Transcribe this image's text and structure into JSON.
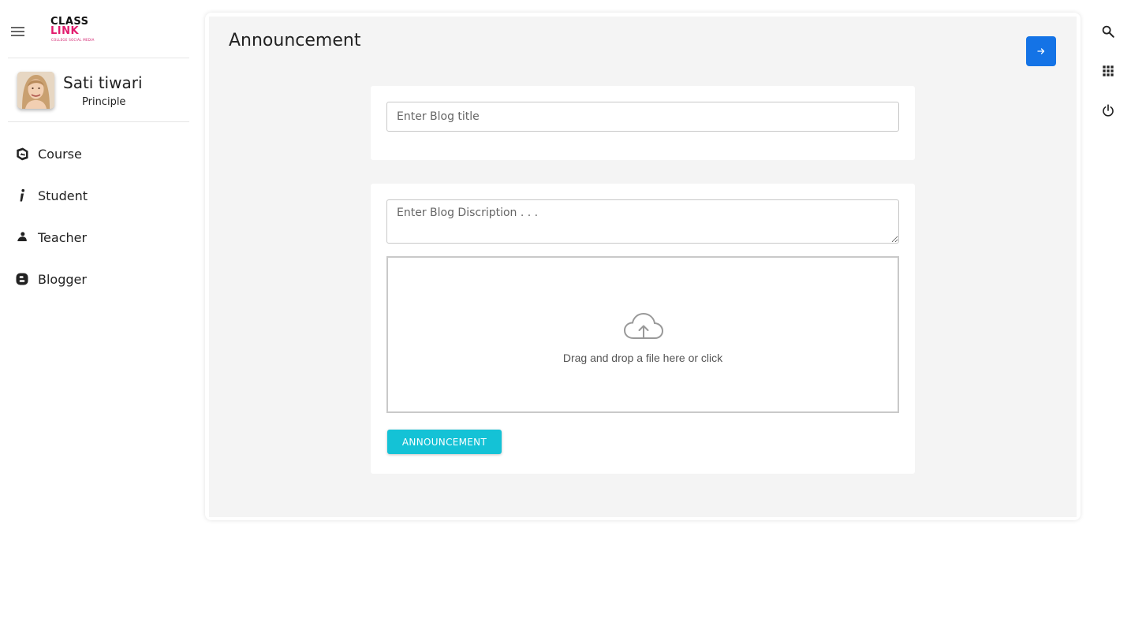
{
  "app": {
    "logo_line1": "CLASS",
    "logo_line2": "LINK",
    "logo_tagline": "COLLEGE SOCIAL MEDIA"
  },
  "sidebar": {
    "menu_icon": "hamburger-menu-icon",
    "user": {
      "name": "Sati tiwari",
      "role": "Principle"
    },
    "items": [
      {
        "label": "Course",
        "icon": "course-icon"
      },
      {
        "label": "Student",
        "icon": "student-icon"
      },
      {
        "label": "Teacher",
        "icon": "teacher-icon"
      },
      {
        "label": "Blogger",
        "icon": "blogger-icon"
      }
    ]
  },
  "main": {
    "title": "Announcement",
    "blog_title_placeholder": "Enter Blog title",
    "blog_title_value": "",
    "description_placeholder": "Enter Blog Discription . . .",
    "description_value": "",
    "dropzone_text": "Drag and drop a file here or click",
    "submit_label": "ANNOUNCEMENT",
    "go_button_icon": "arrow-right-icon"
  },
  "right_toolbar": [
    {
      "icon": "search-icon"
    },
    {
      "icon": "apps-grid-icon"
    },
    {
      "icon": "power-icon"
    }
  ],
  "colors": {
    "primary_button": "#1473e6",
    "accent_button": "#14c2d6",
    "content_bg": "#f4f4f4",
    "logo_accent": "#e21c6e"
  }
}
